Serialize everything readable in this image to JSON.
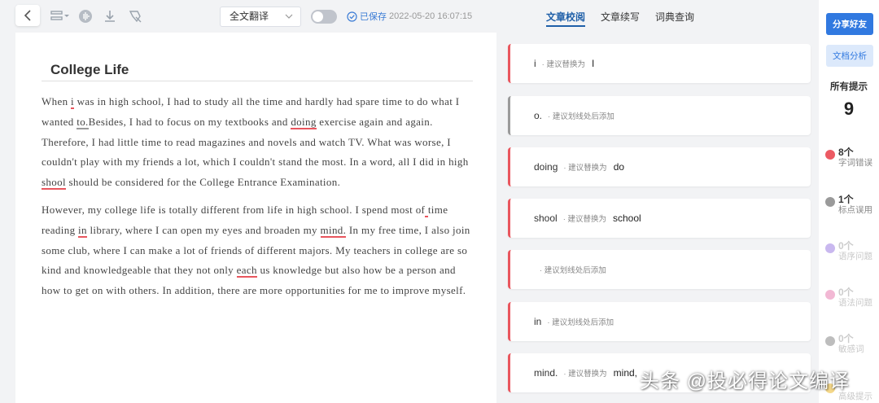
{
  "toolbar": {
    "translate_select": "全文翻译",
    "saved_label": "已保存",
    "saved_time": "2022-05-20 16:07:15"
  },
  "tabs": [
    {
      "label": "文章校阅",
      "active": true
    },
    {
      "label": "文章续写",
      "active": false
    },
    {
      "label": "词典查询",
      "active": false
    }
  ],
  "document": {
    "title": "College Life",
    "p1": [
      "When ",
      "i",
      " was in high school, I had to study all the time and hardly had spare time to do what I wanted ",
      "to.",
      "Besides, I had to focus on my textbooks and ",
      "doing",
      " exercise again and again. Therefore, I had little time to read magazines and novels and watch TV. What was worse, I couldn't play with my friends a lot, which I couldn't stand the most. In a word, all I did in high ",
      "shool",
      " should be considered for the College Entrance Examination."
    ],
    "p2": [
      "However, my college life is totally different from life in high school. I spend most of",
      " ",
      "time reading ",
      "in",
      " library, where I can open my eyes and broaden my ",
      "mind.",
      " In my free time, I also join some club, where I can make a lot of friends of different majors. My teachers in college are so kind and knowledgeable that they not only ",
      "each",
      " us knowledge but also how be a person and how to get on with others. In addition, there are more opportunities for me to improve myself."
    ]
  },
  "suggestions": [
    {
      "original": "i",
      "hint": "· 建议替换为",
      "suggestion": "I"
    },
    {
      "original": "o.",
      "hint": "· 建议划线处后添加",
      "suggestion": ""
    },
    {
      "original": "doing",
      "hint": "· 建议替换为",
      "suggestion": "do"
    },
    {
      "original": "shool",
      "hint": "· 建议替换为",
      "suggestion": "school"
    },
    {
      "original": "",
      "hint": "· 建议划线处后添加",
      "suggestion": ""
    },
    {
      "original": "in",
      "hint": "· 建议划线处后添加",
      "suggestion": ""
    },
    {
      "original": "mind.",
      "hint": "· 建议替换为",
      "suggestion": "mind,"
    }
  ],
  "sidebar": {
    "share_label": "分享好友",
    "analyze_label": "文档分析",
    "all_label": "所有提示",
    "all_count": "9",
    "stats": [
      {
        "count": "8个",
        "label": "字词错误",
        "color": "#ec5a63"
      },
      {
        "count": "1个",
        "label": "标点误用",
        "color": "#9a9a9a"
      },
      {
        "count": "0个",
        "label": "语序问题",
        "color": "#c9b8ef"
      },
      {
        "count": "0个",
        "label": "语法问题",
        "color": "#f2b8d4"
      },
      {
        "count": "0个",
        "label": "敏感词",
        "color": "#bdbdbd"
      },
      {
        "count": "",
        "label": "高级提示",
        "color": "#f5d88a"
      }
    ]
  },
  "watermark": "头条 @投必得论文编译"
}
